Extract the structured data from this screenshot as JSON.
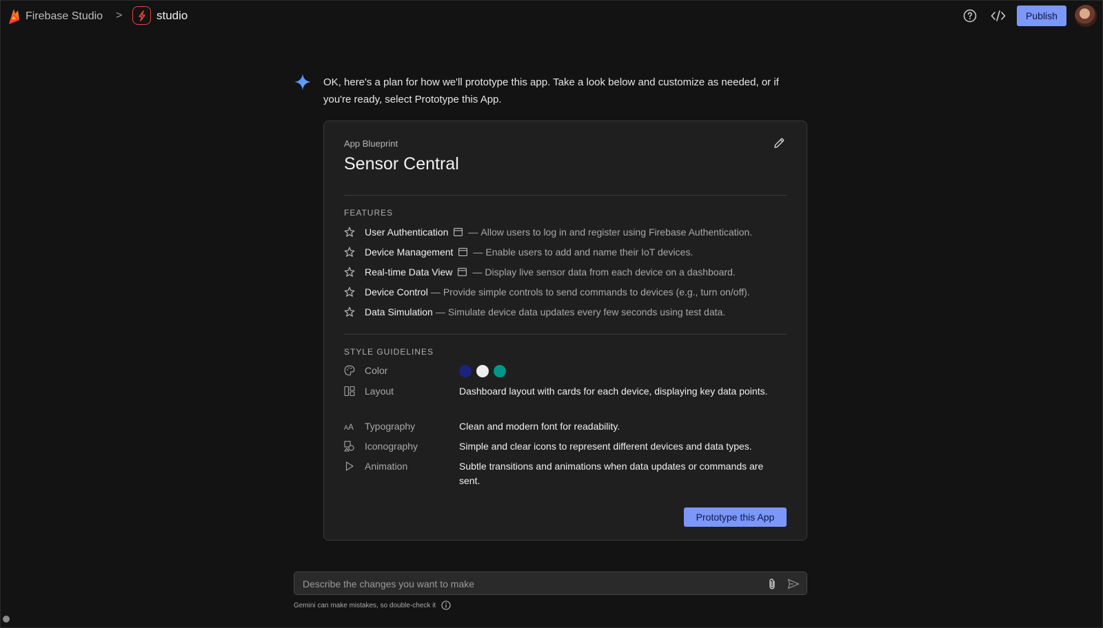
{
  "topbar": {
    "brand_name": "Firebase Studio",
    "breadcrumb_separator": ">",
    "project_name": "studio",
    "publish_label": "Publish"
  },
  "message": {
    "text": "OK, here's a plan for how we'll prototype this app. Take a look below and customize as needed, or if you're ready, select Prototype this App."
  },
  "blueprint": {
    "kicker": "App Blueprint",
    "title": "Sensor Central",
    "features_label": "FEATURES",
    "features": [
      {
        "name": "User Authentication",
        "has_window_icon": true,
        "description": "Allow users to log in and register using Firebase Authentication."
      },
      {
        "name": "Device Management",
        "has_window_icon": true,
        "description": "Enable users to add and name their IoT devices."
      },
      {
        "name": "Real-time Data View",
        "has_window_icon": true,
        "description": "Display live sensor data from each device on a dashboard."
      },
      {
        "name": "Device Control",
        "has_window_icon": false,
        "description": "Provide simple controls to send commands to devices (e.g., turn on/off)."
      },
      {
        "name": "Data Simulation",
        "has_window_icon": false,
        "description": "Simulate device data updates every few seconds using test data."
      }
    ],
    "dash": "—",
    "style_label": "STYLE GUIDELINES",
    "style": {
      "color": {
        "label": "Color",
        "icon": "palette-icon",
        "swatches": [
          "#1a237e",
          "#eeeeee",
          "#009688"
        ]
      },
      "layout": {
        "label": "Layout",
        "icon": "layout-icon",
        "value": "Dashboard layout with cards for each device, displaying key data points."
      },
      "typography": {
        "label": "Typography",
        "icon": "typography-icon",
        "value": "Clean and modern font for readability."
      },
      "iconography": {
        "label": "Iconography",
        "icon": "shapes-icon",
        "value": "Simple and clear icons to represent different devices and data types."
      },
      "animation": {
        "label": "Animation",
        "icon": "play-icon",
        "value": "Subtle transitions and animations when data updates or commands are sent."
      }
    },
    "prototype_label": "Prototype this App"
  },
  "composer": {
    "placeholder": "Describe the changes you want to make",
    "disclaimer": "Gemini can make mistakes, so double-check it"
  },
  "colors": {
    "accent": "#7b97f7",
    "background": "#131313",
    "card": "#1f1f1f"
  }
}
